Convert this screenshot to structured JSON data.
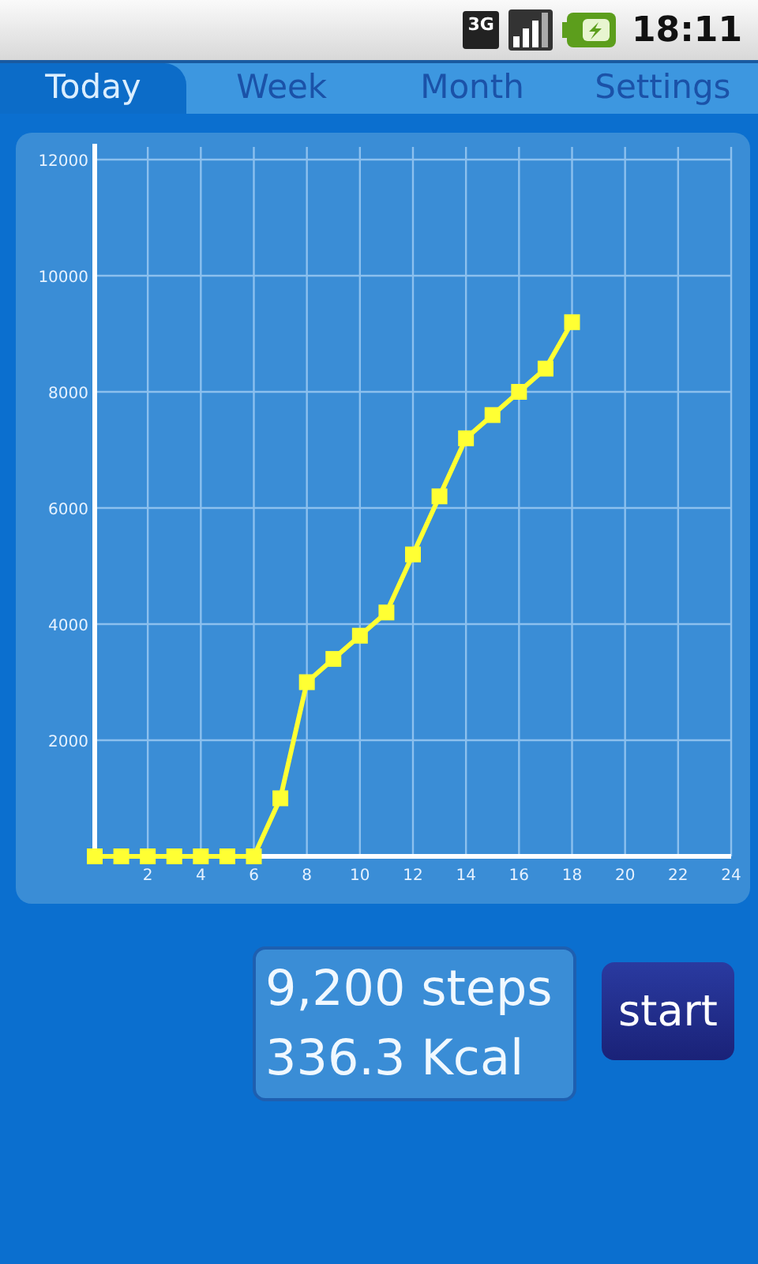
{
  "status_bar": {
    "network": "3G",
    "time": "18:11"
  },
  "tabs": [
    {
      "label": "Today",
      "selected": true
    },
    {
      "label": "Week",
      "selected": false
    },
    {
      "label": "Month",
      "selected": false
    },
    {
      "label": "Settings",
      "selected": false
    }
  ],
  "chart": {
    "chart_data": {
      "type": "line",
      "x": [
        0,
        1,
        2,
        3,
        4,
        5,
        6,
        7,
        8,
        9,
        10,
        11,
        12,
        13,
        14,
        15,
        16,
        17,
        18
      ],
      "grid": true,
      "series": [
        {
          "color": "#ffff33",
          "marker": "square",
          "values": [
            0,
            0,
            0,
            0,
            0,
            0,
            0,
            1000,
            3000,
            3400,
            3800,
            4200,
            5200,
            6200,
            7200,
            7600,
            8000,
            8400,
            9200
          ]
        }
      ],
      "xlim": [
        0,
        24
      ],
      "ylim": [
        0,
        12000
      ],
      "xticks": [
        2,
        4,
        6,
        8,
        10,
        12,
        14,
        16,
        18,
        20,
        22,
        24
      ],
      "yticks": [
        2000,
        4000,
        6000,
        8000,
        10000,
        12000
      ]
    }
  },
  "summary": {
    "steps": "9,200 steps",
    "calories": "336.3 Kcal"
  },
  "start_button": {
    "label": "start"
  }
}
